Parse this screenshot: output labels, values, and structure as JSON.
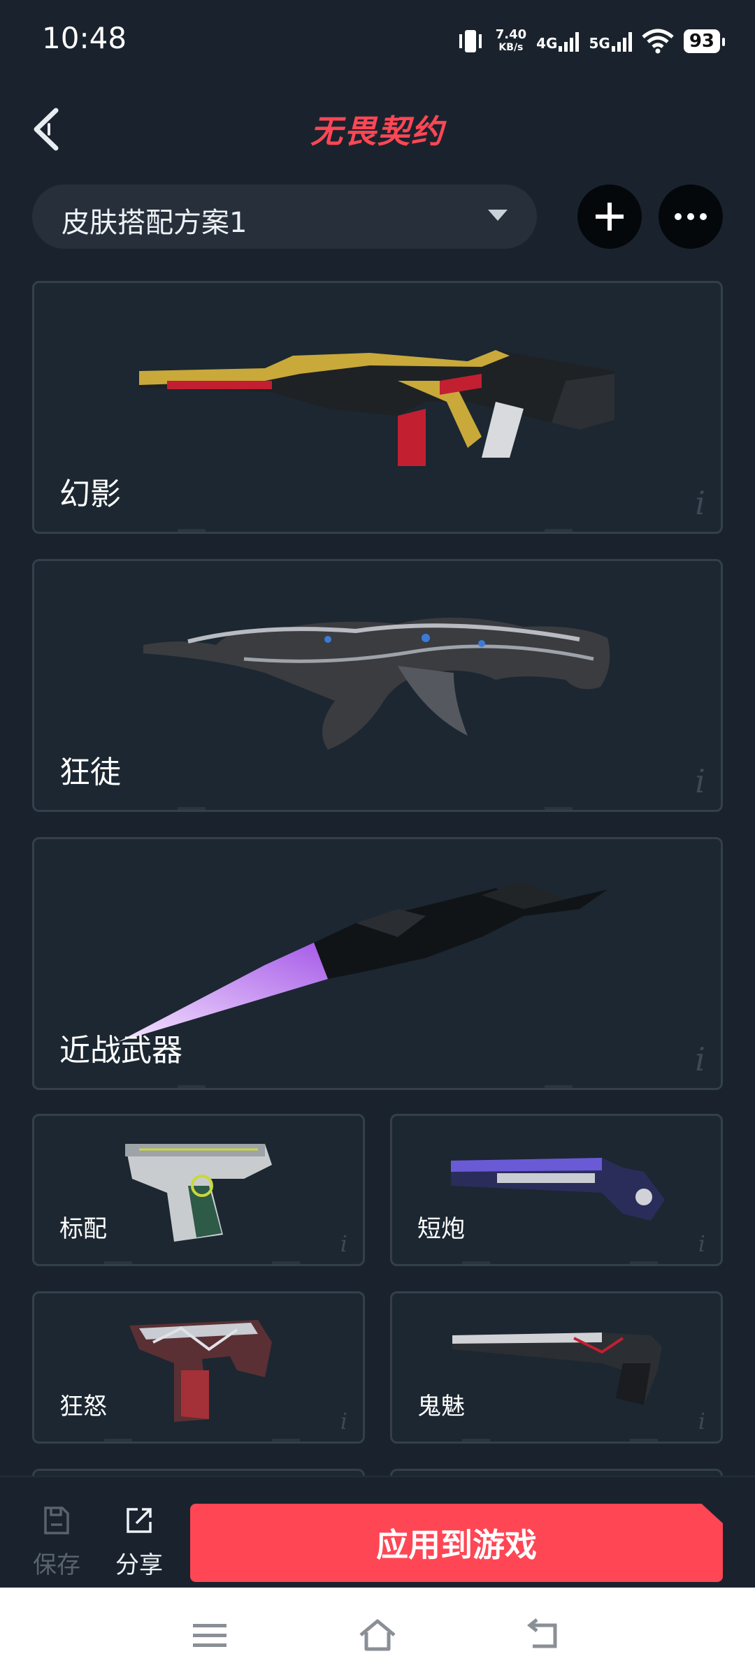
{
  "status_bar": {
    "time": "10:48",
    "speed_value": "7.40",
    "speed_unit": "KB/s",
    "net1": "4G",
    "net2": "5G",
    "battery": "93"
  },
  "header": {
    "title": "无畏契约"
  },
  "plan_selector": {
    "label": "皮肤搭配方案1"
  },
  "weapons": [
    {
      "name": "幻影"
    },
    {
      "name": "狂徒"
    },
    {
      "name": "近战武器"
    },
    {
      "name": "标配"
    },
    {
      "name": "短炮"
    },
    {
      "name": "狂怒"
    },
    {
      "name": "鬼魅"
    }
  ],
  "bottom_bar": {
    "save_label": "保存",
    "share_label": "分享",
    "apply_label": "应用到游戏"
  },
  "colors": {
    "accent": "#ff4655",
    "background": "#1a232d",
    "card": "#1c2731"
  }
}
